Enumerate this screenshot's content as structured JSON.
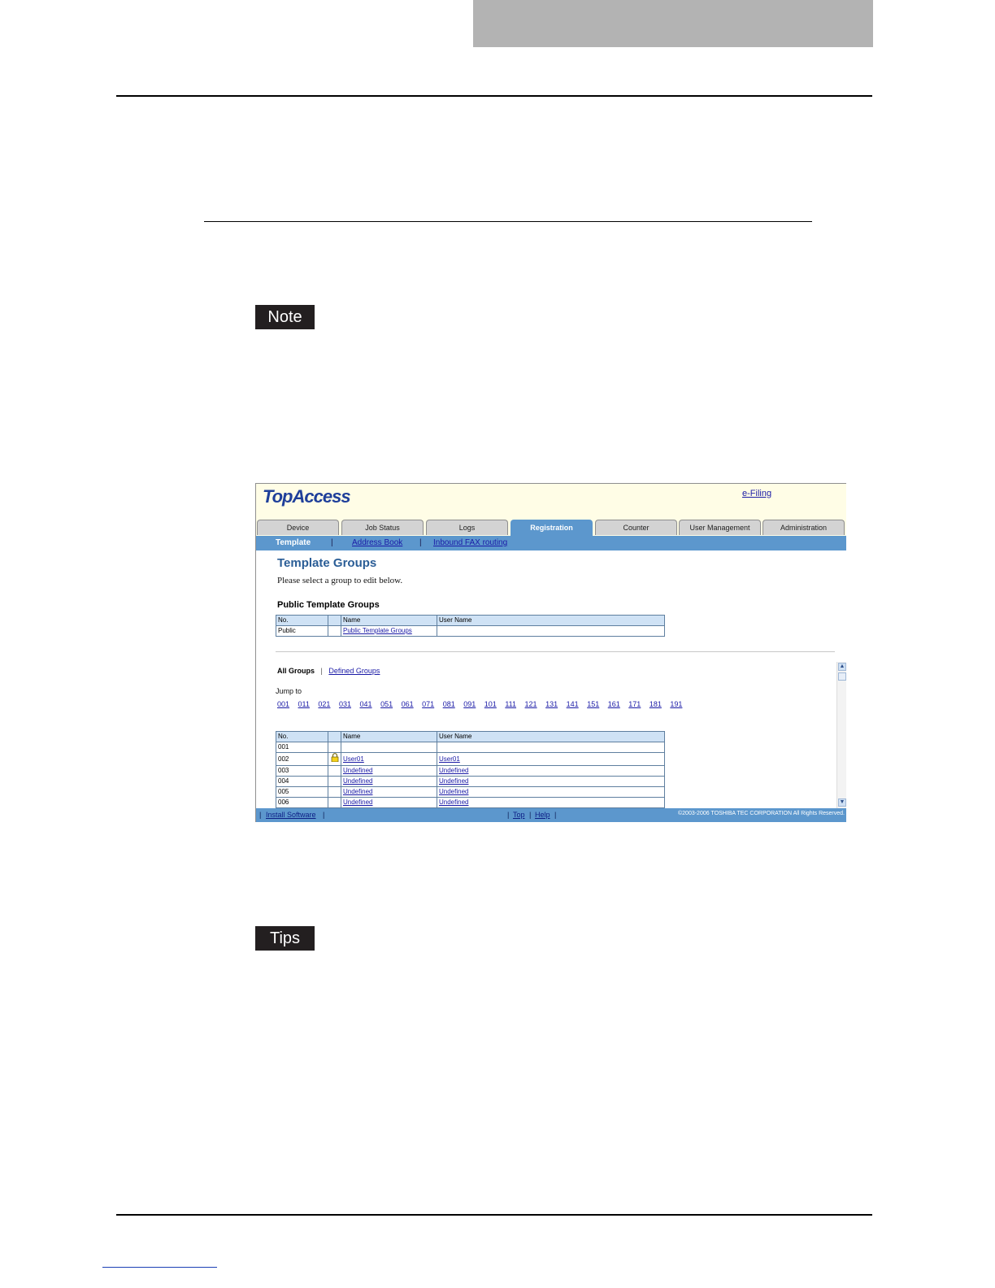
{
  "document": {
    "note_label": "Note",
    "tips_label": "Tips"
  },
  "topaccess": {
    "logo": "TopAccess",
    "efiling_link": "e-Filing",
    "tabs": [
      {
        "label": "Device"
      },
      {
        "label": "Job Status"
      },
      {
        "label": "Logs"
      },
      {
        "label": "Registration",
        "active": true
      },
      {
        "label": "Counter"
      },
      {
        "label": "User Management"
      },
      {
        "label": "Administration"
      }
    ],
    "subnav": {
      "active": "Template",
      "links": [
        "Address Book",
        "Inbound FAX routing"
      ],
      "separator": "|"
    },
    "main": {
      "title": "Template Groups",
      "instruction": "Please select a group to edit below.",
      "public_heading": "Public Template Groups",
      "public_table": {
        "headers": [
          "No.",
          "",
          "Name",
          "User Name"
        ],
        "rows": [
          {
            "no": "Public",
            "lock": false,
            "name": "Public Template Groups",
            "user": ""
          }
        ]
      },
      "group_nav": {
        "all": "All Groups",
        "separator": "|",
        "defined": "Defined Groups"
      },
      "jump_label": "Jump to",
      "jump_links": [
        "001",
        "011",
        "021",
        "031",
        "041",
        "051",
        "061",
        "071",
        "081",
        "091",
        "101",
        "111",
        "121",
        "131",
        "141",
        "151",
        "161",
        "171",
        "181",
        "191"
      ],
      "groups_table": {
        "headers": [
          "No.",
          "",
          "Name",
          "User Name"
        ],
        "rows": [
          {
            "no": "001",
            "lock": false,
            "name": "",
            "user": ""
          },
          {
            "no": "002",
            "lock": true,
            "name": "User01",
            "user": "User01"
          },
          {
            "no": "003",
            "lock": false,
            "name": "Undefined",
            "user": "Undefined"
          },
          {
            "no": "004",
            "lock": false,
            "name": "Undefined",
            "user": "Undefined"
          },
          {
            "no": "005",
            "lock": false,
            "name": "Undefined",
            "user": "Undefined"
          },
          {
            "no": "006",
            "lock": false,
            "name": "Undefined",
            "user": "Undefined"
          }
        ]
      }
    },
    "footer": {
      "install_software": "Install Software",
      "top": "Top",
      "help": "Help",
      "separator": "|",
      "copyright": "©2003-2006 TOSHIBA TEC CORPORATION All Rights Reserved."
    },
    "colors": {
      "tab_active": "#5c97cd",
      "header_bg": "#fffde6",
      "title": "#2a5d96",
      "link": "#1a1aa6"
    }
  }
}
